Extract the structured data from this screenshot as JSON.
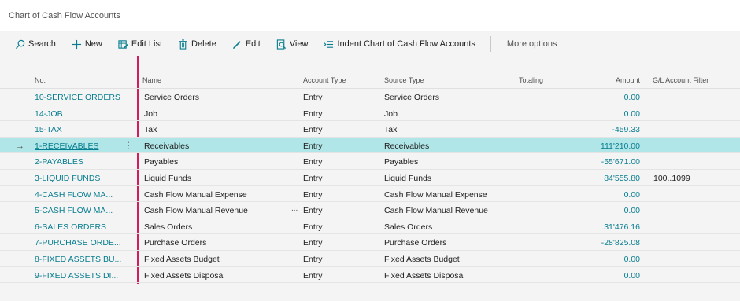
{
  "window": {
    "title": "Chart of Cash Flow Accounts"
  },
  "toolbar": {
    "search": "Search",
    "new": "New",
    "edit_list": "Edit List",
    "delete": "Delete",
    "edit": "Edit",
    "view": "View",
    "indent": "Indent Chart of Cash Flow Accounts",
    "more": "More options"
  },
  "columns": {
    "no": "No.",
    "name": "Name",
    "account_type": "Account Type",
    "source_type": "Source Type",
    "totaling": "Totaling",
    "amount": "Amount",
    "gl_filter": "G/L Account Filter"
  },
  "rows": [
    {
      "no": "10-SERVICE ORDERS",
      "name": "Service Orders",
      "type": "Entry",
      "source": "Service Orders",
      "amount": "0.00",
      "gl": ""
    },
    {
      "no": "14-JOB",
      "name": "Job",
      "type": "Entry",
      "source": "Job",
      "amount": "0.00",
      "gl": ""
    },
    {
      "no": "15-TAX",
      "name": "Tax",
      "type": "Entry",
      "source": "Tax",
      "amount": "-459.33",
      "gl": ""
    },
    {
      "no": "1-RECEIVABLES",
      "name": "Receivables",
      "type": "Entry",
      "source": "Receivables",
      "amount": "111'210.00",
      "gl": ""
    },
    {
      "no": "2-PAYABLES",
      "name": "Payables",
      "type": "Entry",
      "source": "Payables",
      "amount": "-55'671.00",
      "gl": ""
    },
    {
      "no": "3-LIQUID FUNDS",
      "name": "Liquid Funds",
      "type": "Entry",
      "source": "Liquid Funds",
      "amount": "84'555.80",
      "gl": "100..1099"
    },
    {
      "no": "4-CASH FLOW MA...",
      "name": "Cash Flow Manual Expense",
      "type": "Entry",
      "source": "Cash Flow Manual Expense",
      "amount": "0.00",
      "gl": ""
    },
    {
      "no": "5-CASH FLOW MA...",
      "name": "Cash Flow Manual Revenue",
      "type": "Entry",
      "source": "Cash Flow Manual Revenue",
      "amount": "0.00",
      "gl": ""
    },
    {
      "no": "6-SALES ORDERS",
      "name": "Sales Orders",
      "type": "Entry",
      "source": "Sales Orders",
      "amount": "31'476.16",
      "gl": ""
    },
    {
      "no": "7-PURCHASE ORDE...",
      "name": "Purchase Orders",
      "type": "Entry",
      "source": "Purchase Orders",
      "amount": "-28'825.08",
      "gl": ""
    },
    {
      "no": "8-FIXED ASSETS BU...",
      "name": "Fixed Assets Budget",
      "type": "Entry",
      "source": "Fixed Assets Budget",
      "amount": "0.00",
      "gl": ""
    },
    {
      "no": "9-FIXED ASSETS DI...",
      "name": "Fixed Assets Disposal",
      "type": "Entry",
      "source": "Fixed Assets Disposal",
      "amount": "0.00",
      "gl": ""
    }
  ],
  "selected_row_marker": "→",
  "row_menu_glyph": "⋮",
  "name_overflow_glyph": "...",
  "colors": {
    "accent": "#087d8f",
    "selected": "#b0e6e8",
    "frozen_line": "#d31c5f"
  }
}
